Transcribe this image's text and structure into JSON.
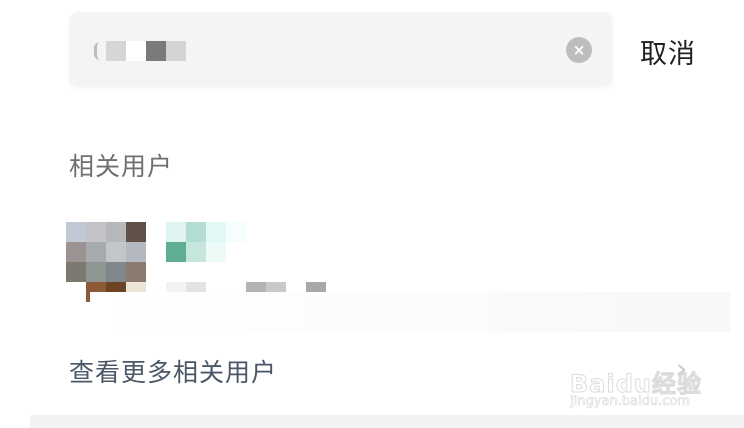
{
  "search": {
    "query_pixels": [
      "#d6d6d6",
      "#ffffff",
      "#7a7a7a",
      "#d4d4d4"
    ],
    "clear_icon": "×",
    "cancel_label": "取消"
  },
  "related_users": {
    "section_title": "相关用户",
    "user": {
      "avatar_pixels": [
        [
          "#c2c8d4",
          "#c1c3c6",
          "#b7b8bc",
          "#5f5048"
        ],
        [
          "#9b9291",
          "#a7aaac",
          "#c2c6c9",
          "#b3b8c1"
        ],
        [
          "#7c796f",
          "#8f9591",
          "#7f878d",
          "#8b7b6f"
        ],
        [
          "#ffffff",
          "#8b5a36",
          "#6d4325",
          "#ede4d8"
        ]
      ],
      "name_pixels": [
        [
          "#e0f5f2",
          "#b3ddd2",
          "#e2f8f6",
          "#f6fdfd"
        ],
        [
          "#5fae93",
          "#c5e6dd",
          "#ecfaf8",
          "#ffffff"
        ]
      ],
      "info_pixels": [
        "#f3f3f3",
        "#e3e3e3",
        "#ffffff",
        "#ffffff",
        "#b4b4b4",
        "#c9c9c9",
        "#ffffff",
        "#a8a8a8"
      ]
    },
    "more_label": "查看更多相关用户",
    "more_icon": "›"
  },
  "watermark": {
    "brand": "Baidu经验",
    "url": "jingyan.baidu.com"
  }
}
